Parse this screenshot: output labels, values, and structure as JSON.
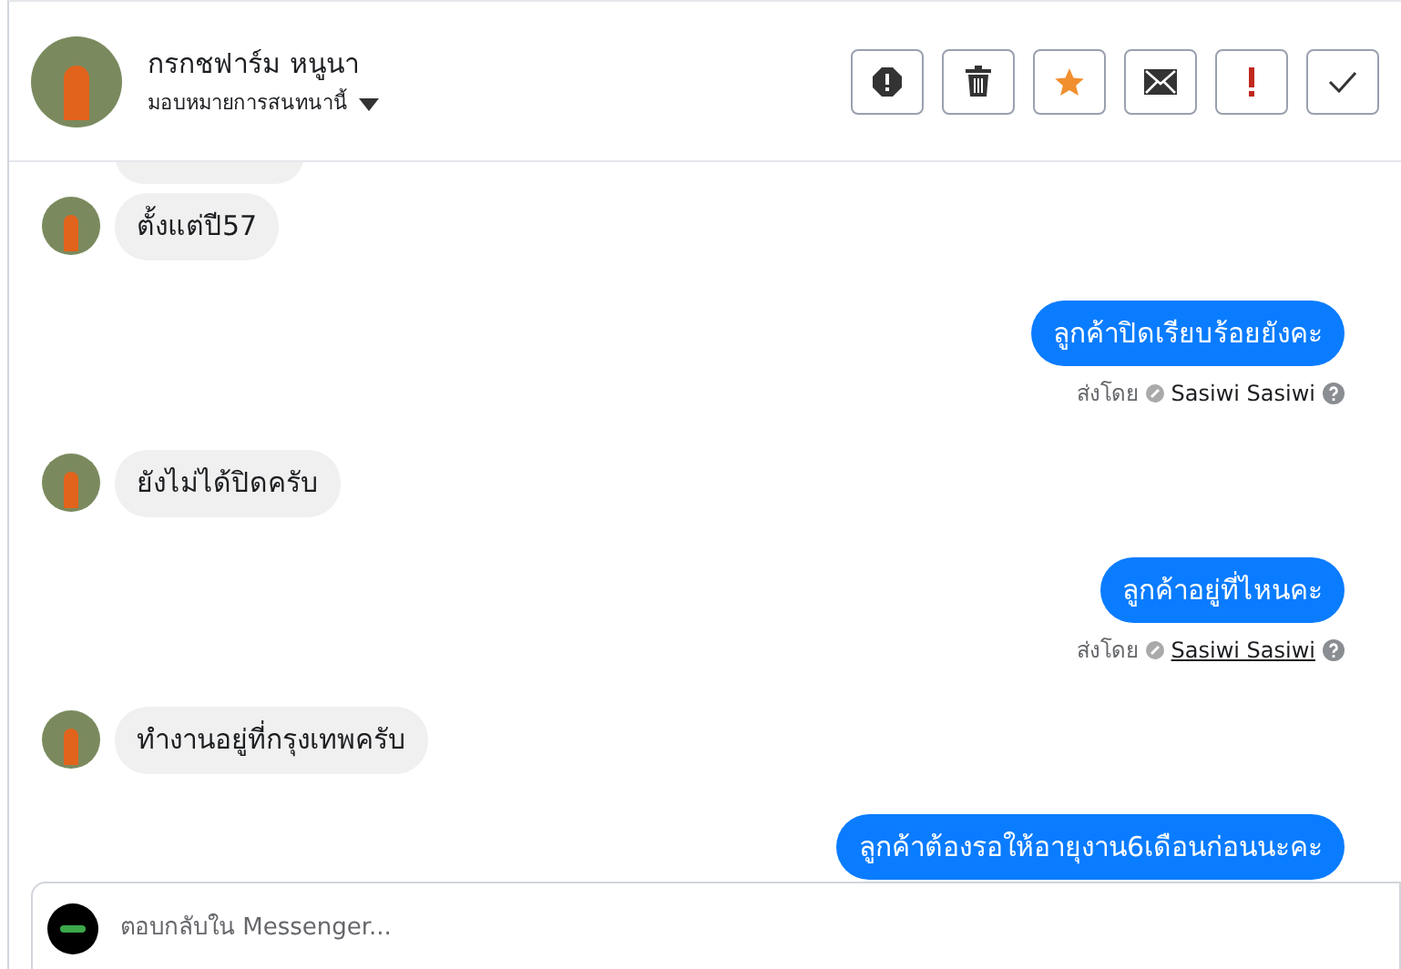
{
  "header": {
    "name": "กรกชฟาร์ม หนูนา",
    "assign_label": "มอบหมายการสนทนานี้"
  },
  "actions": [
    {
      "kind": "alert"
    },
    {
      "kind": "trash"
    },
    {
      "kind": "star"
    },
    {
      "kind": "mail"
    },
    {
      "kind": "important"
    },
    {
      "kind": "check"
    }
  ],
  "messages": [
    {
      "kind": "incoming",
      "text": "ตั้งแต่ปี57"
    },
    {
      "kind": "outgoing",
      "text": "ลูกค้าปิดเรียบร้อยยังคะ",
      "sent_by_label": "ส่งโดย",
      "sender": "Sasiwi Sasiwi",
      "hovered": false
    },
    {
      "kind": "incoming",
      "text": "ยังไม่ได้ปิดครับ"
    },
    {
      "kind": "outgoing",
      "text": "ลูกค้าอยู่ที่ไหนคะ",
      "sent_by_label": "ส่งโดย",
      "sender": "Sasiwi Sasiwi",
      "hovered": true
    },
    {
      "kind": "incoming",
      "text": "ทำงานอยู่ที่กรุงเทพครับ"
    },
    {
      "kind": "outgoing",
      "text": "ลูกค้าต้องรอให้อายุงาน6เดือนก่อนนะคะ"
    }
  ],
  "reply": {
    "placeholder": "ตอบกลับใน Messenger..."
  }
}
